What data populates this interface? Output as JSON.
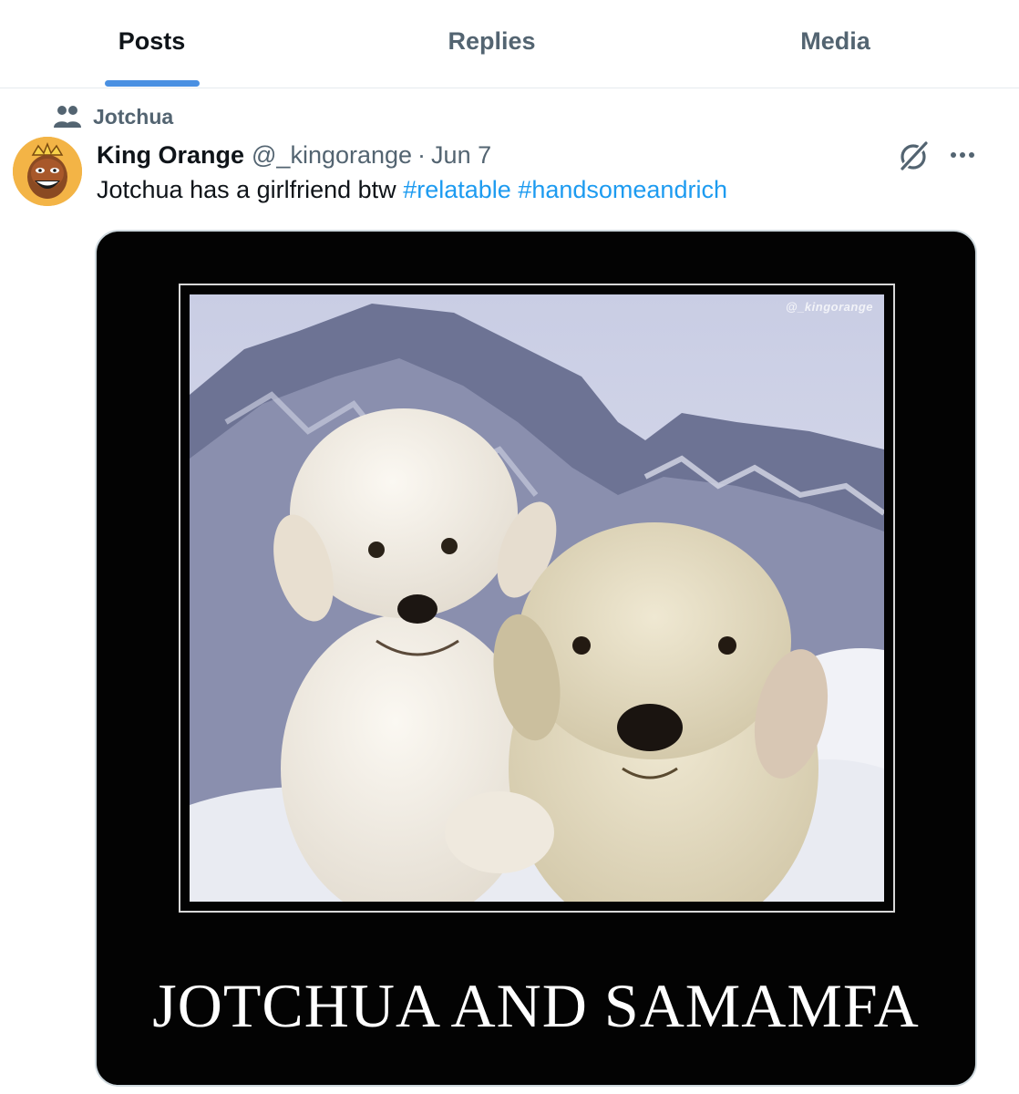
{
  "tabs": [
    {
      "label": "Posts",
      "active": true
    },
    {
      "label": "Replies",
      "active": false
    },
    {
      "label": "Media",
      "active": false
    }
  ],
  "post": {
    "social_context": "Jotchua",
    "display_name": "King Orange",
    "handle": "@_kingorange",
    "separator": "·",
    "date": "Jun 7",
    "text": "Jotchua has a girlfriend btw",
    "hashtags": [
      "#relatable",
      "#handsomeandrich"
    ],
    "icons": {
      "context": "community-icon",
      "grok": "grok-icon",
      "more": "more-icon"
    },
    "media": {
      "watermark": "@_kingorange",
      "caption": "JOTCHUA AND SAMAMFA"
    }
  },
  "colors": {
    "accent": "#1d9bf0",
    "tab_indicator": "#4a90e2",
    "muted_text": "#536471",
    "primary_text": "#0f1419"
  }
}
